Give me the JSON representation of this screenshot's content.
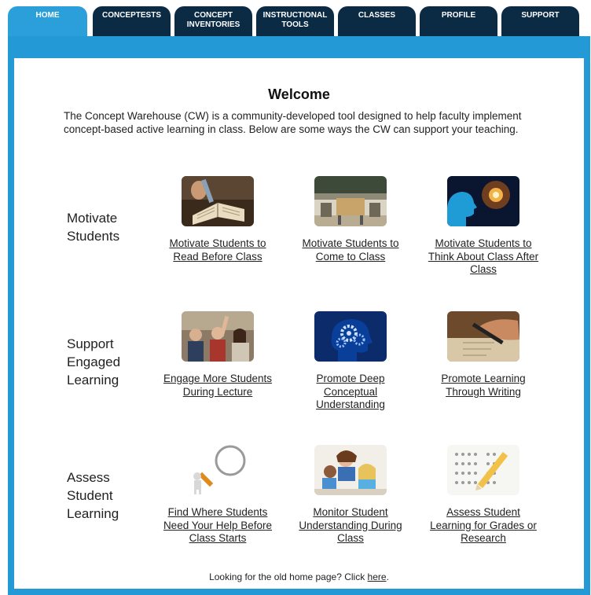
{
  "nav": {
    "tabs": [
      {
        "line1": "HOME",
        "line2": "",
        "active": true
      },
      {
        "line1": "CONCEPTESTS",
        "line2": "",
        "active": false
      },
      {
        "line1": "CONCEPT",
        "line2": "INVENTORIES",
        "active": false
      },
      {
        "line1": "INSTRUCTIONAL",
        "line2": "TOOLS",
        "active": false
      },
      {
        "line1": "CLASSES",
        "line2": "",
        "active": false
      },
      {
        "line1": "PROFILE",
        "line2": "",
        "active": false
      },
      {
        "line1": "SUPPORT",
        "line2": "",
        "active": false
      }
    ]
  },
  "main": {
    "title": "Welcome",
    "intro": "The Concept Warehouse (CW) is a community-developed tool designed to help faculty implement concept-based active learning in class. Below are some ways the CW can support your teaching."
  },
  "sections": [
    {
      "label_lines": [
        "Motivate",
        "Students"
      ],
      "cards": [
        {
          "link": "Motivate Students to Read Before Class",
          "icon": "open-book-image"
        },
        {
          "link": "Motivate Students to Come to Class",
          "icon": "classroom-desk-image"
        },
        {
          "link": "Motivate Students to Think About Class After Class",
          "icon": "thinking-silhouette-image"
        }
      ]
    },
    {
      "label_lines": [
        "Support",
        "Engaged",
        "Learning"
      ],
      "cards": [
        {
          "link": "Engage More Students During Lecture",
          "icon": "raised-hands-image"
        },
        {
          "link": "Promote Deep Conceptual Understanding",
          "icon": "brain-gears-image"
        },
        {
          "link": "Promote Learning Through Writing",
          "icon": "pen-writing-image"
        }
      ]
    },
    {
      "label_lines": [
        "Assess",
        "Student",
        "Learning"
      ],
      "cards": [
        {
          "link": "Find Where Students Need Your Help Before Class Starts",
          "icon": "magnifying-glass-image"
        },
        {
          "link": "Monitor Student Understanding During Class",
          "icon": "students-studying-image"
        },
        {
          "link": "Assess Student Learning for Grades or Research",
          "icon": "answer-sheet-pencil-image"
        }
      ]
    }
  ],
  "footer": {
    "text": "Looking for the old home page? Click ",
    "link": "here",
    "end": "."
  },
  "colors": {
    "tab_bg": "#0b2a44",
    "tab_active": "#2a9fd9",
    "frame": "#239ad5"
  }
}
